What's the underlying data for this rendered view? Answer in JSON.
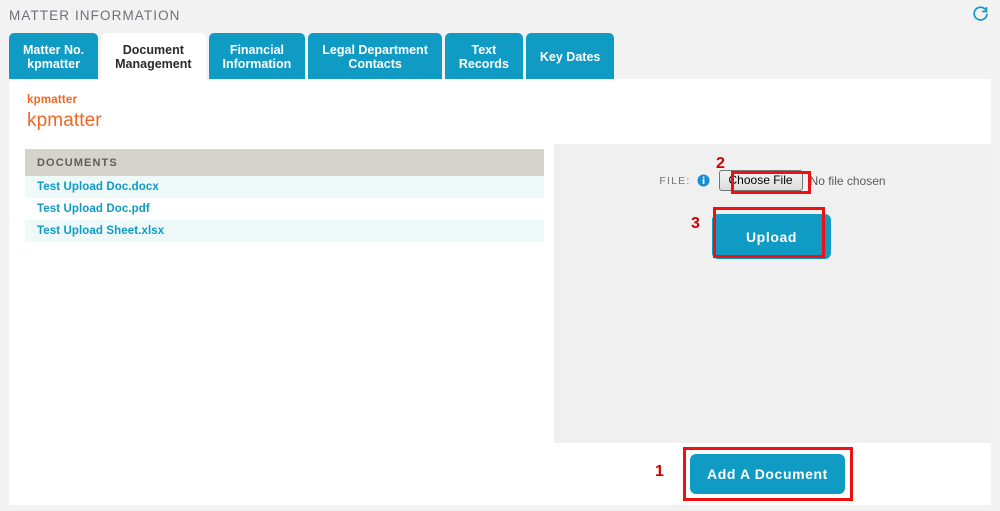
{
  "header": {
    "title": "MATTER INFORMATION",
    "refresh_icon": "refresh-icon"
  },
  "tabs": [
    {
      "line1": "Matter No.",
      "line2": "kpmatter",
      "active": false
    },
    {
      "line1": "Document",
      "line2": "Management",
      "active": true
    },
    {
      "line1": "Financial",
      "line2": "Information",
      "active": false
    },
    {
      "line1": "Legal Department",
      "line2": "Contacts",
      "active": false
    },
    {
      "line1": "Text",
      "line2": "Records",
      "active": false
    },
    {
      "line1": "Key Dates",
      "line2": "",
      "active": false
    }
  ],
  "breadcrumb": "kpmatter",
  "matter_title": "kpmatter",
  "documents": {
    "header": "DOCUMENTS",
    "items": [
      "Test Upload Doc.docx",
      "Test Upload Doc.pdf",
      "Test Upload Sheet.xlsx"
    ]
  },
  "upload": {
    "file_label": "FILE:",
    "info_icon": "info-circle-icon",
    "choose_file_label": "Choose File",
    "no_file_text": "No file chosen",
    "upload_label": "Upload"
  },
  "add_document_label": "Add A Document",
  "annotations": [
    {
      "number": "1",
      "target": "Add A Document"
    },
    {
      "number": "2",
      "target": "Choose File"
    },
    {
      "number": "3",
      "target": "Upload"
    }
  ],
  "colors": {
    "teal": "#0f9bc4",
    "orange": "#f26522",
    "annotation_red": "#ee1111",
    "docs_header_gray": "#d6d3cd",
    "panel_gray": "#f0f0f0",
    "page_gray": "#f2f2f2"
  }
}
